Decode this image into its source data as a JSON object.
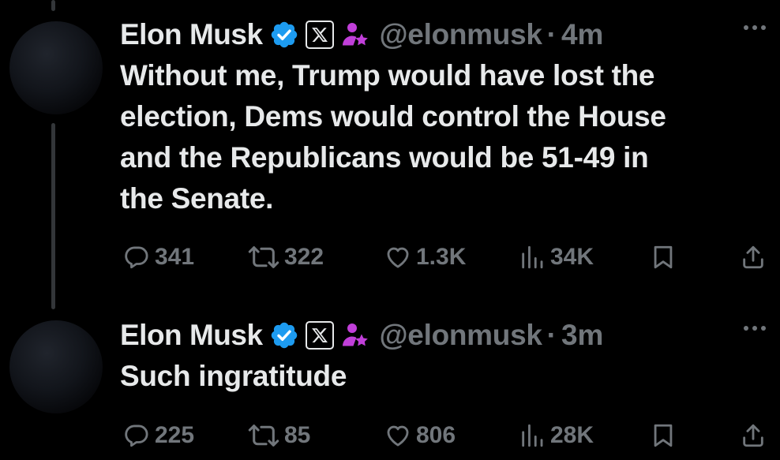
{
  "tweets": [
    {
      "name": "Elon Musk",
      "handle": "@elonmusk",
      "separator": "·",
      "time": "4m",
      "text_lines": [
        "Without me, Trump would have lost the",
        "election, Dems would control the House",
        "and the Republicans would be 51-49 in",
        "the Senate."
      ],
      "replies": "341",
      "reposts": "322",
      "likes": "1.3K",
      "views": "34K"
    },
    {
      "name": "Elon Musk",
      "handle": "@elonmusk",
      "separator": "·",
      "time": "3m",
      "text_lines": [
        "Such ingratitude"
      ],
      "replies": "225",
      "reposts": "85",
      "likes": "806",
      "views": "28K"
    }
  ],
  "icons": {
    "verified": "verified-badge-icon",
    "x_logo": "x-logo-icon",
    "affiliate": "affiliate-person-icon",
    "more": "more-options-icon",
    "reply": "reply-icon",
    "repost": "repost-icon",
    "like": "heart-icon",
    "views": "views-chart-icon",
    "bookmark": "bookmark-icon",
    "share": "share-icon"
  },
  "colors": {
    "background": "#000000",
    "text": "#e7e9ea",
    "secondary": "#71767b",
    "verified": "#1d9bf0",
    "affiliate": "#c13fd9"
  }
}
